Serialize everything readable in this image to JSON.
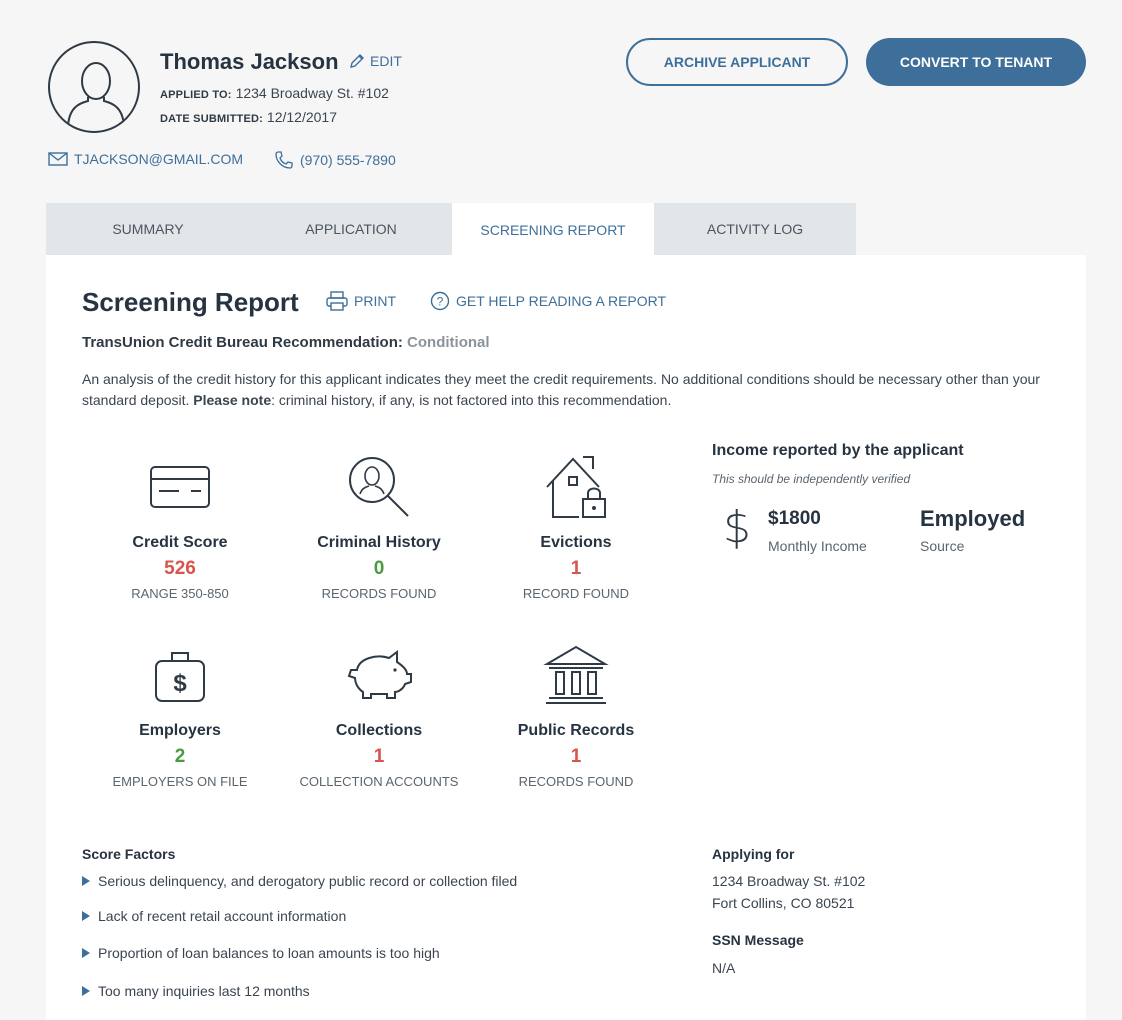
{
  "applicant": {
    "name": "Thomas Jackson",
    "edit_label": "EDIT",
    "applied_to_label": "APPLIED TO:",
    "applied_to_value": "1234 Broadway St. #102",
    "date_label": "DATE SUBMITTED:",
    "date_value": "12/12/2017",
    "email": "TJACKSON@GMAIL.COM",
    "phone": "(970) 555-7890"
  },
  "actions": {
    "archive_label": "ARCHIVE APPLICANT",
    "convert_label": "CONVERT TO TENANT"
  },
  "tabs": [
    {
      "label": "SUMMARY",
      "active": false
    },
    {
      "label": "APPLICATION",
      "active": false
    },
    {
      "label": "SCREENING REPORT",
      "active": true
    },
    {
      "label": "ACTIVITY LOG",
      "active": false
    }
  ],
  "report": {
    "title": "Screening Report",
    "print_label": "PRINT",
    "help_label": "GET HELP READING A REPORT",
    "recommendation_label": "TransUnion Credit Bureau Recommendation:",
    "recommendation_value": "Conditional",
    "para_part1": "An analysis of the credit history for this applicant indicates they meet the credit requirements. No additional conditions should be necessary other than your standard deposit. ",
    "para_bold": "Please note",
    "para_part2": ": criminal history, if any, is not factored into this recommendation."
  },
  "stats": [
    {
      "title": "Credit Score",
      "value": "526",
      "sub": "RANGE 350-850",
      "icon": "credit-card-icon",
      "color": "#d9534f"
    },
    {
      "title": "Criminal History",
      "value": "0",
      "sub": "RECORDS FOUND",
      "icon": "magnifier-person-icon",
      "color": "#4a9a3f"
    },
    {
      "title": "Evictions",
      "value": "1",
      "sub": "RECORD FOUND",
      "icon": "house-lock-icon",
      "color": "#d9534f"
    },
    {
      "title": "Employers",
      "value": "2",
      "sub": "EMPLOYERS ON FILE",
      "icon": "briefcase-dollar-icon",
      "color": "#4a9a3f"
    },
    {
      "title": "Collections",
      "value": "1",
      "sub": "COLLECTION ACCOUNTS",
      "icon": "piggy-bank-icon",
      "color": "#d9534f"
    },
    {
      "title": "Public Records",
      "value": "1",
      "sub": "RECORDS FOUND",
      "icon": "bank-building-icon",
      "color": "#d9534f"
    }
  ],
  "income": {
    "title": "Income reported by the applicant",
    "note": "This should be independently verified",
    "amount": "$1800",
    "amount_label": "Monthly Income",
    "source": "Employed",
    "source_label": "Source"
  },
  "score_factors": {
    "title": "Score Factors",
    "items": [
      "Serious delinquency, and derogatory public record or collection filed",
      "Lack of recent retail account information",
      "Proportion of loan balances to loan amounts is too high",
      "Too many inquiries last 12 months"
    ]
  },
  "applying_for": {
    "title": "Applying for",
    "line1": "1234 Broadway St. #102",
    "line2": "Fort Collins, CO 80521"
  },
  "ssn": {
    "title": "SSN Message",
    "value": "N/A"
  }
}
